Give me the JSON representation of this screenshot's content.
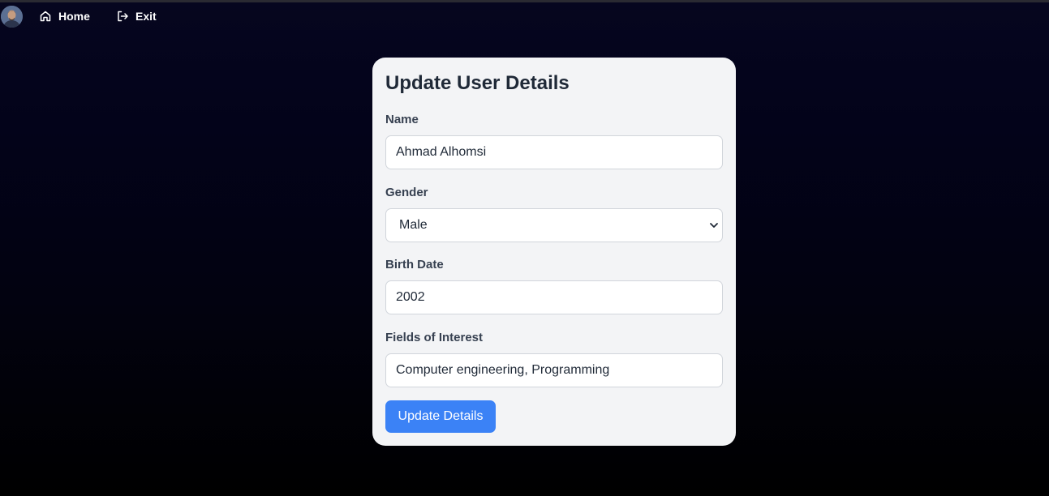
{
  "nav": {
    "home_label": "Home",
    "exit_label": "Exit"
  },
  "form": {
    "title": "Update User Details",
    "name": {
      "label": "Name",
      "value": "Ahmad Alhomsi"
    },
    "gender": {
      "label": "Gender",
      "selected": "Male"
    },
    "birth_date": {
      "label": "Birth Date",
      "value": "2002"
    },
    "interests": {
      "label": "Fields of Interest",
      "value": "Computer engineering, Programming"
    },
    "submit_label": "Update Details"
  },
  "colors": {
    "accent": "#3b82f6",
    "card_bg": "#f3f4f6",
    "page_bg_top": "#06061f",
    "page_bg_bottom": "#000000"
  },
  "icons": {
    "home": "home-icon",
    "exit": "exit-icon",
    "select": "chevron-down-icon"
  }
}
